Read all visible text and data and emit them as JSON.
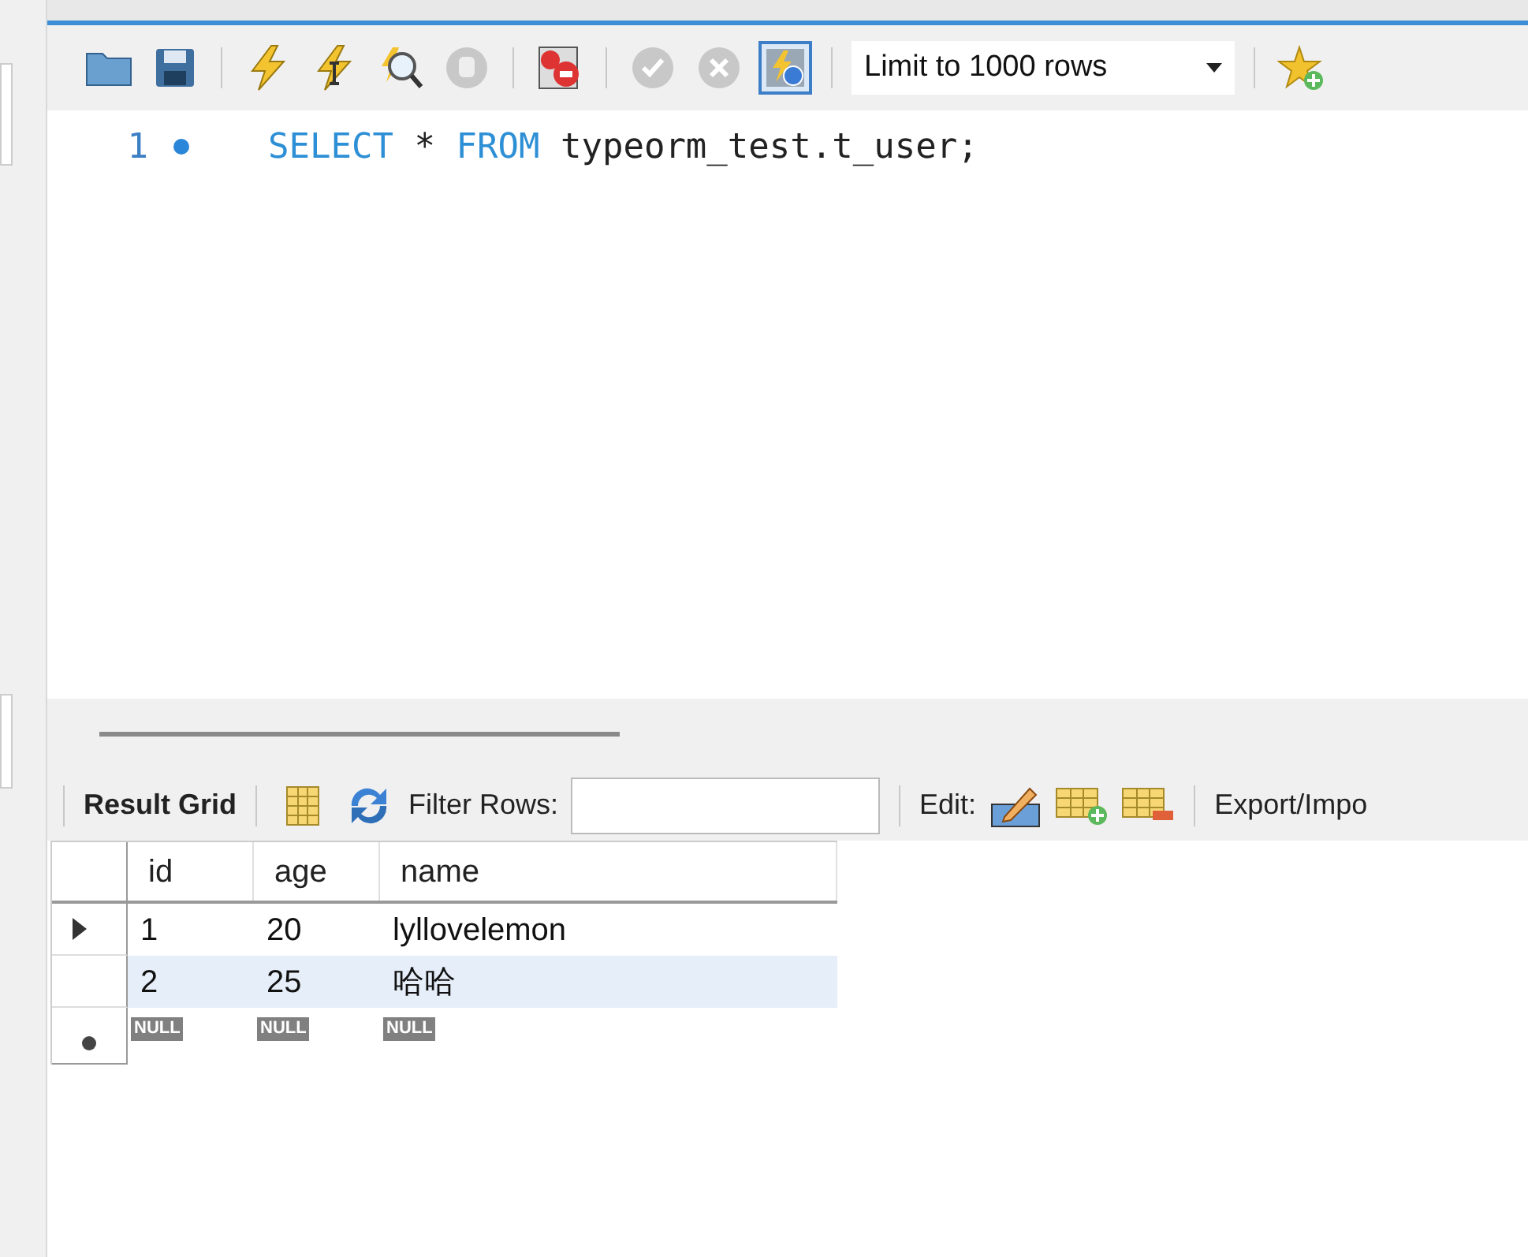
{
  "toolbar": {
    "limit_select": {
      "value": "Limit to 1000 rows"
    },
    "auto_commit_on": true
  },
  "editor": {
    "lines": [
      {
        "number": "1",
        "marker": true,
        "tokens": [
          {
            "kind": "keyword",
            "text": "SELECT"
          },
          {
            "kind": "plain",
            "text": " * "
          },
          {
            "kind": "keyword",
            "text": "FROM"
          },
          {
            "kind": "plain",
            "text": " typeorm_test.t_user;"
          }
        ]
      }
    ]
  },
  "result_toolbar": {
    "view_label": "Result Grid",
    "filter_label": "Filter Rows:",
    "edit_label": "Edit:",
    "export_label": "Export/Impo"
  },
  "grid": {
    "columns": [
      "id",
      "age",
      "name"
    ],
    "rows": [
      {
        "cells": [
          "1",
          "20",
          "lyllovelemon"
        ],
        "current": true,
        "selected": false
      },
      {
        "cells": [
          "2",
          "25",
          "哈哈"
        ],
        "current": false,
        "selected": true
      }
    ],
    "new_row": [
      "NULL",
      "NULL",
      "NULL"
    ]
  }
}
